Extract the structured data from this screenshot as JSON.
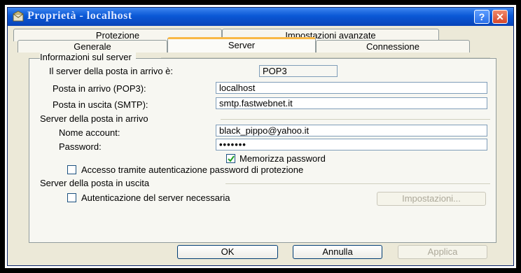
{
  "window": {
    "title": "Proprietà - localhost",
    "help_label": "?",
    "close_label": "✕"
  },
  "tabs": {
    "row1": [
      "Protezione",
      "Impostazioni avanzate"
    ],
    "row2": [
      "Generale",
      "Server",
      "Connessione"
    ],
    "active": "Server"
  },
  "server_info": {
    "header": "Informazioni sul server",
    "incoming_type_label": "Il server della posta in arrivo è:",
    "incoming_type_value": "POP3",
    "incoming_label": "Posta in arrivo (POP3):",
    "incoming_value": "localhost",
    "outgoing_label": "Posta in uscita (SMTP):",
    "outgoing_value": "smtp.fastwebnet.it"
  },
  "incoming_server": {
    "header": "Server della posta in arrivo",
    "account_label": "Nome account:",
    "account_value": "black_pippo@yahoo.it",
    "password_label": "Password:",
    "password_value": "•••••••",
    "remember_label": "Memorizza password",
    "remember_checked": true,
    "spa_label": "Accesso tramite autenticazione password di protezione",
    "spa_checked": false
  },
  "outgoing_server": {
    "header": "Server della posta in uscita",
    "auth_label": "Autenticazione del server necessaria",
    "auth_checked": false,
    "settings_button": "Impostazioni..."
  },
  "buttons": {
    "ok": "OK",
    "cancel": "Annulla",
    "apply": "Applica"
  },
  "colors": {
    "titlebar": "#0a58d6",
    "dialog_bg": "#ece9d8",
    "active_tab_accent": "#f9b845"
  }
}
